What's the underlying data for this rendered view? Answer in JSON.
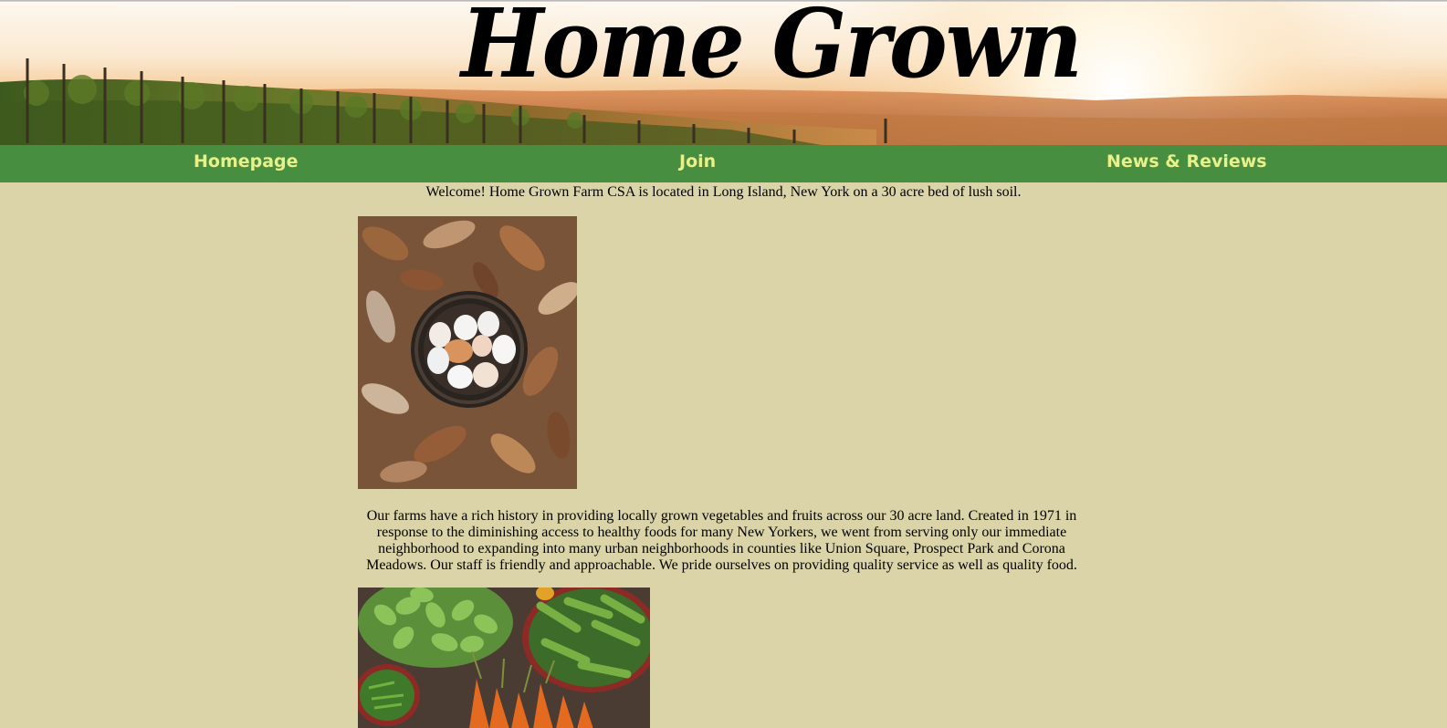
{
  "header": {
    "title": "Home Grown",
    "banner_image": "vineyard-sunset-banner"
  },
  "nav": {
    "items": [
      {
        "label": "Homepage"
      },
      {
        "label": "Join"
      },
      {
        "label": "News & Reviews"
      }
    ]
  },
  "main": {
    "welcome_text": "Welcome! Home Grown Farm CSA is located in Long Island, New York on a 30 acre bed of lush soil.",
    "photo_1": "eggs-in-basket-on-leaves-photo",
    "history_text": "Our farms have a rich history in providing locally grown vegetables and fruits across our 30 acre land. Created in 1971 in response to the diminishing access to healthy foods for many New Yorkers, we went from serving only our immediate neighborhood to expanding into many urban neighborhoods in counties like Union Square, Prospect Park and Corona Meadows. Our staff is friendly and approachable. We pride ourselves on providing quality service as well as quality food.",
    "photo_2": "vegetable-baskets-photo"
  },
  "colors": {
    "page_background": "#dad4a8",
    "nav_background": "#488e40",
    "nav_text": "#e9f08a",
    "text": "#000000"
  }
}
